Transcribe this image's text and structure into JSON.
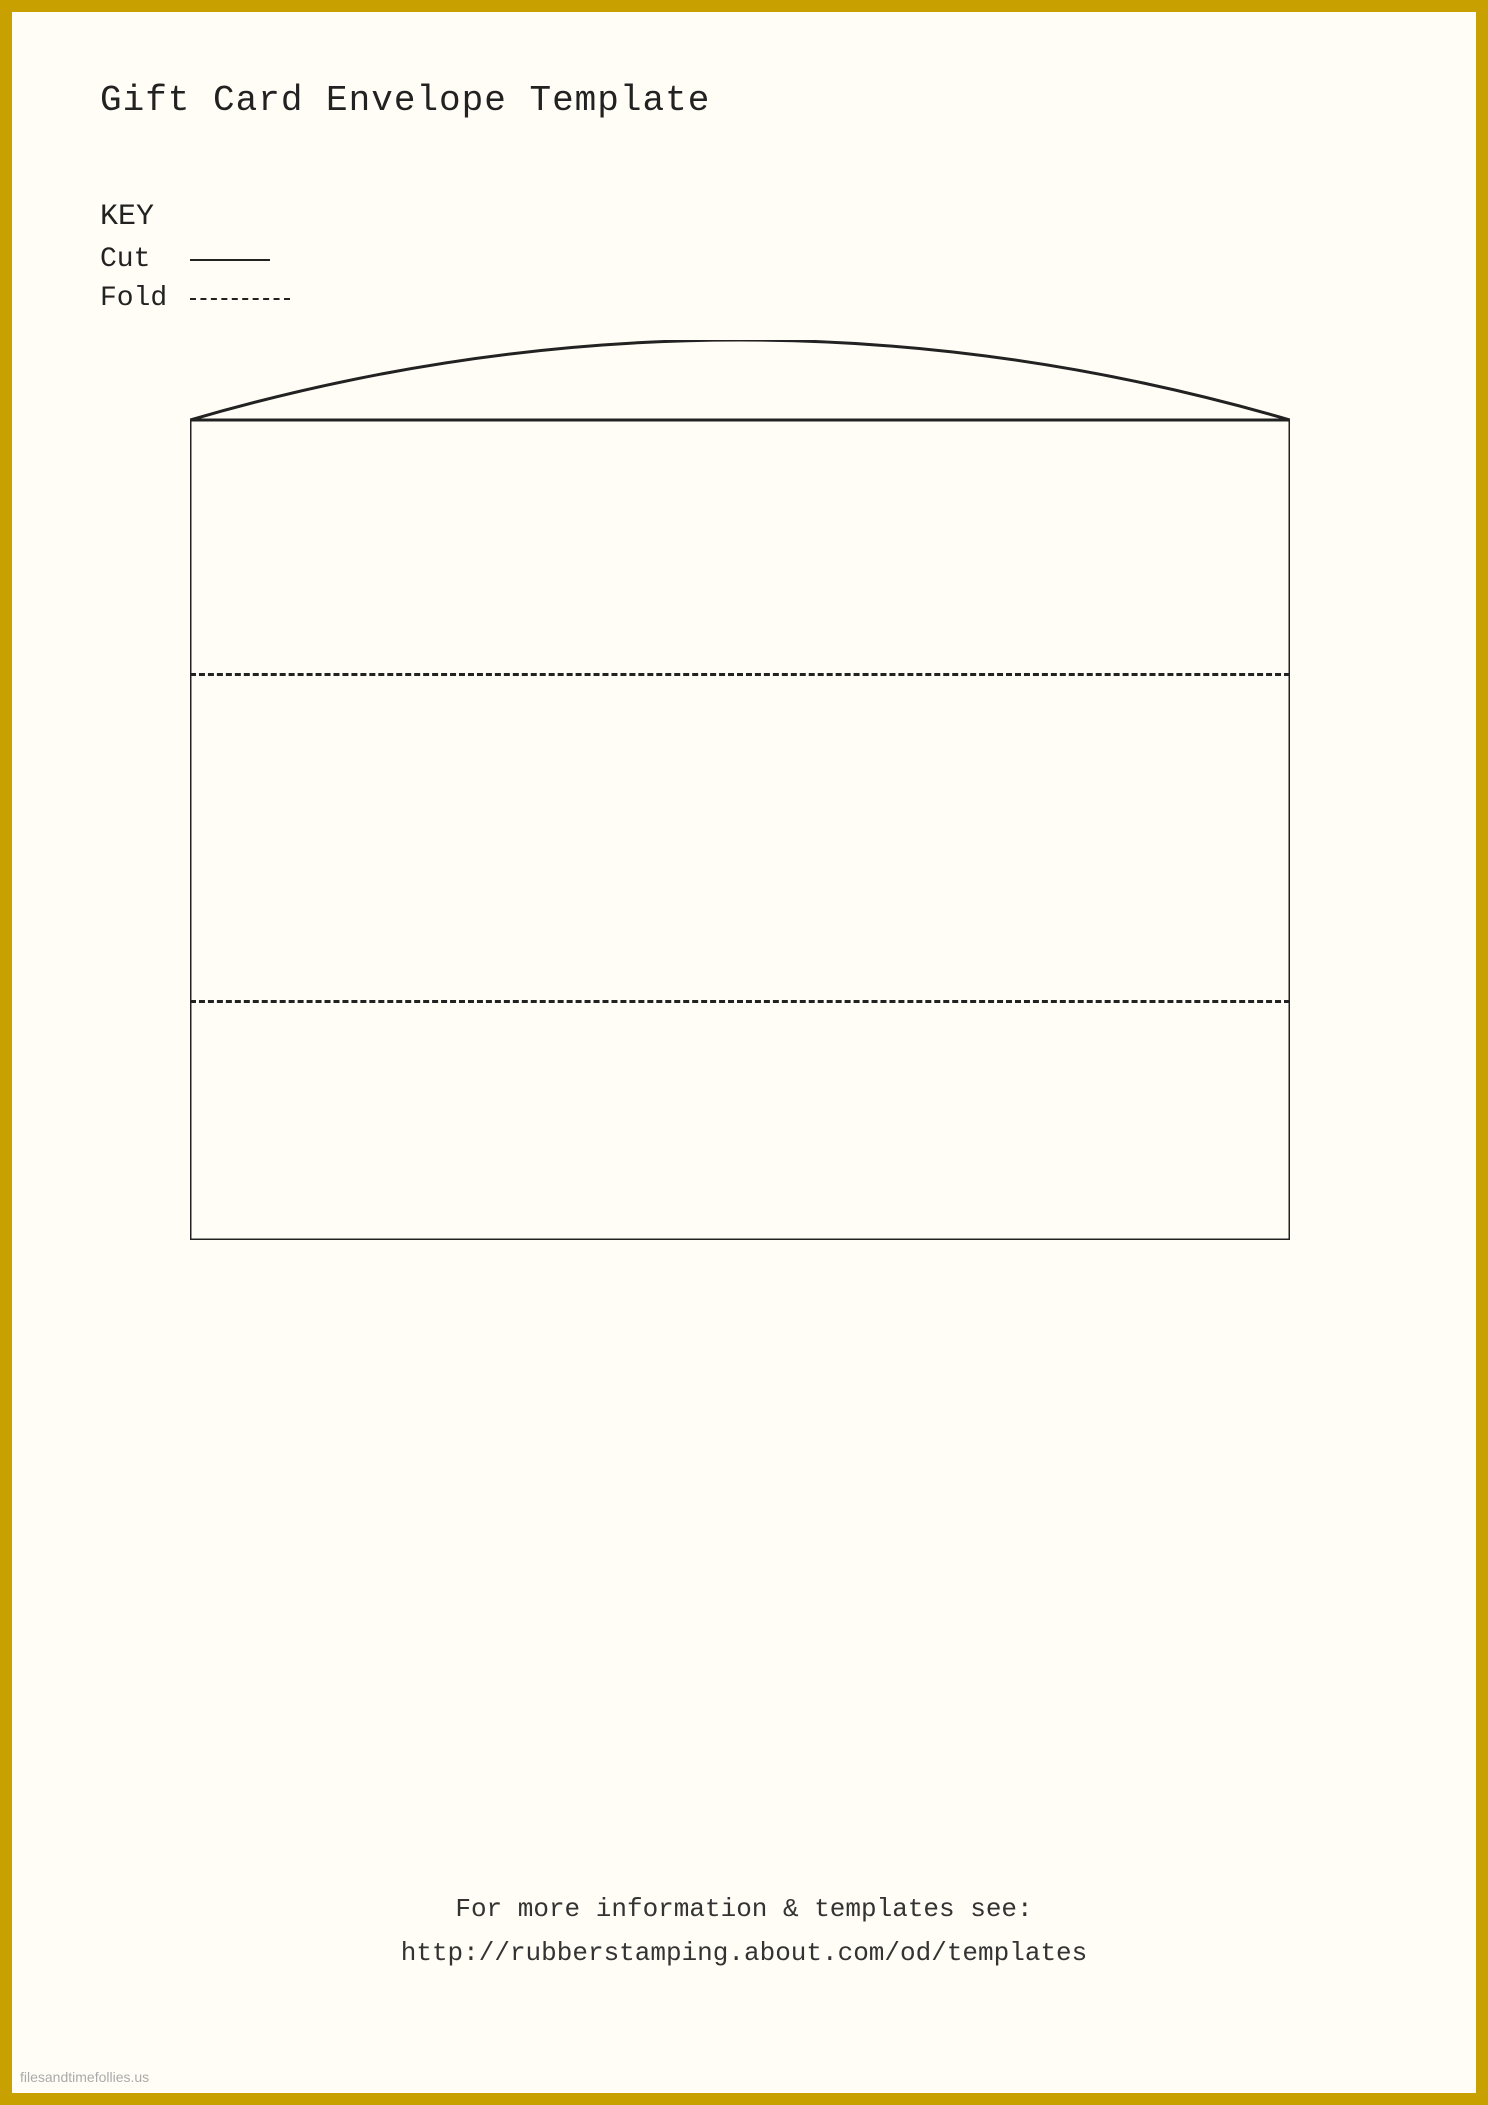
{
  "page": {
    "background_color": "#fffdf5",
    "border_color": "#c8a000"
  },
  "title": "Gift Card Envelope Template",
  "key": {
    "heading": "KEY",
    "items": [
      {
        "label": "Cut",
        "line_type": "solid"
      },
      {
        "label": "Fold",
        "line_type": "dashed"
      }
    ]
  },
  "envelope": {
    "arched_top": true,
    "fold_lines": 2,
    "description": "Gift card envelope template with arched top flap and two fold lines"
  },
  "footer": {
    "line1": "For more information & templates see:",
    "line2": "http://rubberstamping.about.com/od/templates"
  },
  "watermark": "filesandtimefollies.us"
}
